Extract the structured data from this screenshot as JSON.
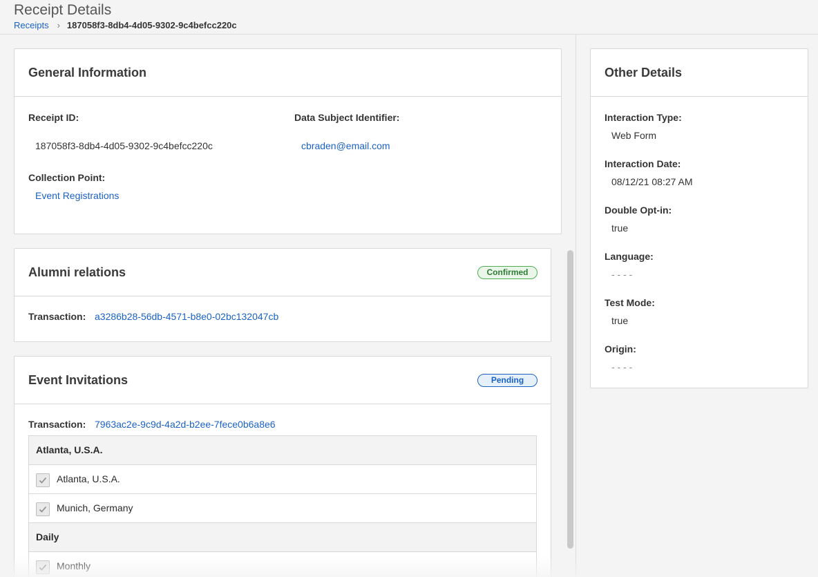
{
  "header": {
    "title": "Receipt Details",
    "breadcrumb_root": "Receipts",
    "breadcrumb_current": "187058f3-8db4-4d05-9302-9c4befcc220c"
  },
  "general": {
    "title": "General Information",
    "receipt_id_label": "Receipt ID:",
    "receipt_id": "187058f3-8db4-4d05-9302-9c4befcc220c",
    "subject_label": "Data Subject Identifier:",
    "subject_value": "cbraden@email.com",
    "collection_label": "Collection Point:",
    "collection_value": "Event Registrations"
  },
  "purposes": [
    {
      "title": "Alumni relations",
      "status": "Confirmed",
      "transaction_label": "Transaction:",
      "transaction": "a3286b28-56db-4571-b8e0-02bc132047cb"
    },
    {
      "title": "Event Invitations",
      "status": "Pending",
      "transaction_label": "Transaction:",
      "transaction": "7963ac2e-9c9d-4a2d-b2ee-7fece0b6a8e6",
      "rows": [
        {
          "type": "group",
          "label": "Atlanta, U.S.A."
        },
        {
          "type": "option",
          "label": "Atlanta, U.S.A.",
          "checked": true
        },
        {
          "type": "option",
          "label": "Munich, Germany",
          "checked": true
        },
        {
          "type": "group",
          "label": "Daily"
        },
        {
          "type": "option",
          "label": "Monthly",
          "checked": true
        }
      ]
    }
  ],
  "other": {
    "title": "Other Details",
    "fields": [
      {
        "label": "Interaction Type:",
        "value": "Web Form"
      },
      {
        "label": "Interaction Date:",
        "value": "08/12/21 08:27 AM"
      },
      {
        "label": "Double Opt-in:",
        "value": "true"
      },
      {
        "label": "Language:",
        "value": "- - - -"
      },
      {
        "label": "Test Mode:",
        "value": "true"
      },
      {
        "label": "Origin:",
        "value": "- - - -"
      }
    ]
  },
  "colors": {
    "link": "#1a62c4",
    "confirmed": "#4caf50",
    "pending": "#1a62c4"
  }
}
